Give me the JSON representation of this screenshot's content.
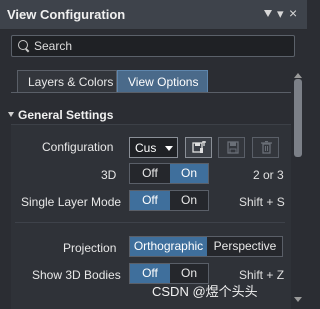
{
  "window": {
    "title": "View Configuration",
    "pin_icon": "pin-icon",
    "close_icon": "close-icon"
  },
  "search": {
    "placeholder": "Search",
    "value": ""
  },
  "tabs": [
    {
      "label": "Layers & Colors",
      "active": false
    },
    {
      "label": "View Options",
      "active": true
    }
  ],
  "section": {
    "title": "General Settings",
    "expanded": true
  },
  "settings": {
    "configuration": {
      "label": "Configuration",
      "value": "Cus",
      "buttons": [
        "save-configuration-as-icon",
        "save-icon",
        "delete-icon"
      ]
    },
    "three_d": {
      "label": "3D",
      "options": [
        "Off",
        "On"
      ],
      "selected": "On",
      "shortcut": "2 or 3"
    },
    "single_layer_mode": {
      "label": "Single Layer Mode",
      "options": [
        "Off",
        "On"
      ],
      "selected": "Off",
      "shortcut": "Shift + S"
    },
    "projection": {
      "label": "Projection",
      "options": [
        "Orthographic",
        "Perspective"
      ],
      "selected": "Orthographic"
    },
    "show_3d_bodies": {
      "label": "Show 3D Bodies",
      "options": [
        "Off",
        "On"
      ],
      "selected": "Off",
      "shortcut": "Shift + Z"
    }
  },
  "watermark": "CSDN @煜个头头",
  "colors": {
    "accent": "#3f6f9c",
    "active_tab": "#4a6a8a",
    "background": "#2b2d33",
    "titlebar": "#3e434b"
  }
}
